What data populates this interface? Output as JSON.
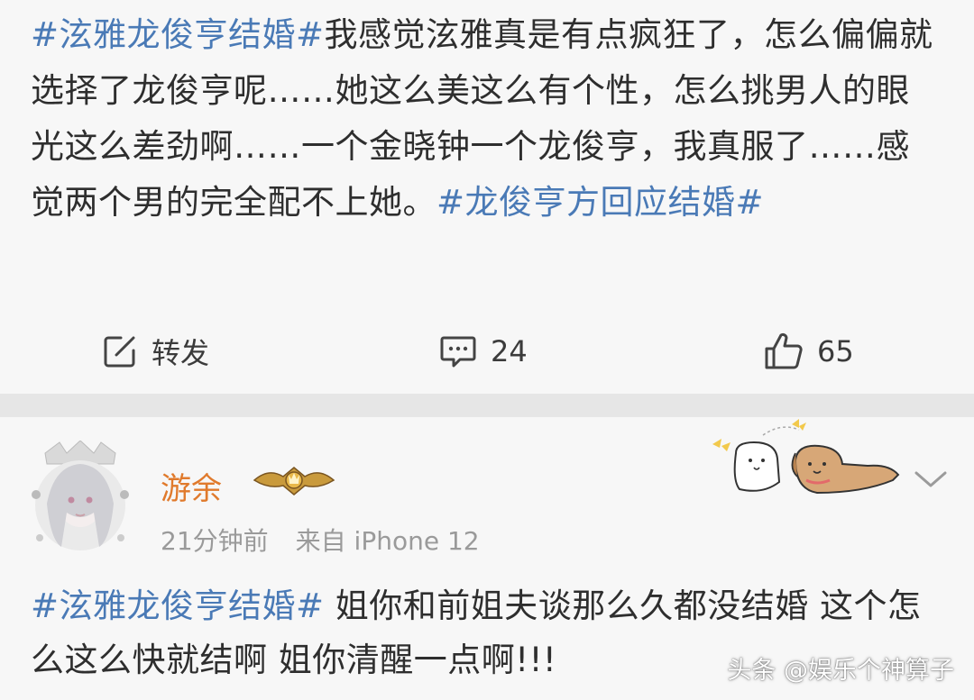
{
  "post1": {
    "tag1": "#泫雅龙俊亨结婚#",
    "body": "我感觉泫雅真是有点疯狂了，怎么偏偏就选择了龙俊亨呢……她这么美这么有个性，怎么挑男人的眼光这么差劲啊……一个金晓钟一个龙俊亨，我真服了……感觉两个男的完全配不上她。",
    "tag2": "#龙俊亨方回应结婚#",
    "actions": {
      "repost_label": "转发",
      "comment_count": "24",
      "like_count": "65"
    }
  },
  "post2": {
    "username": "游余",
    "time": "21分钟前",
    "source": "来自 iPhone 12",
    "tag": "#泫雅龙俊亨结婚#",
    "body": "  姐你和前姐夫谈那么久都没结婚 这个怎么这么快就结啊 姐你清醒一点啊!!!"
  },
  "watermark": "头条 @娱乐个神算子",
  "colors": {
    "tag": "#4a7ab6",
    "username": "#e07a2c",
    "meta": "#9a9a9a",
    "separator": "#e6e6e6"
  },
  "icons": [
    "edit-repost-icon",
    "comment-icon",
    "like-icon",
    "chevron-down-icon",
    "vip-badge-icon"
  ]
}
